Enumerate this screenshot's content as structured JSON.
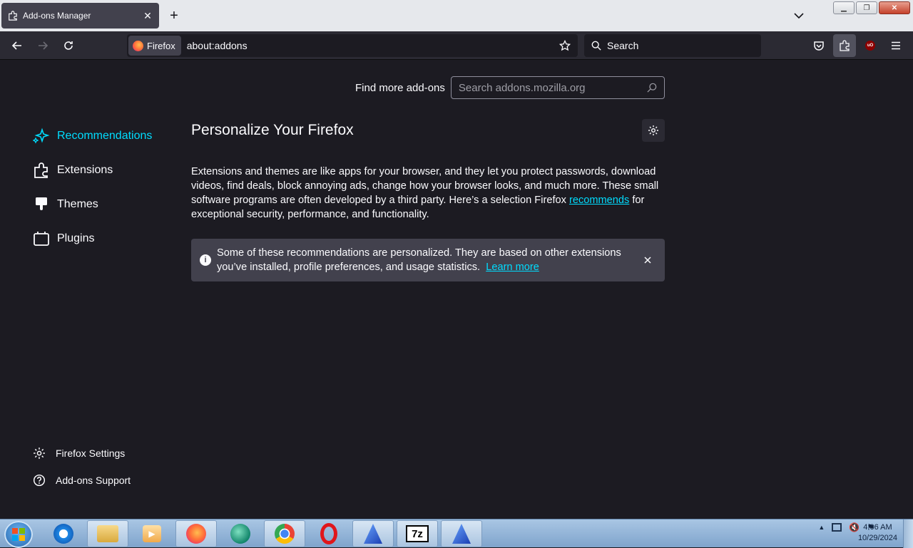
{
  "tab": {
    "title": "Add-ons Manager"
  },
  "navbar": {
    "identity_label": "Firefox",
    "url": "about:addons",
    "search_placeholder": "Search"
  },
  "find_more": {
    "label": "Find more add-ons",
    "search_placeholder": "Search addons.mozilla.org"
  },
  "sidebar": {
    "categories": [
      {
        "label": "Recommendations",
        "icon": "sparkle-icon",
        "selected": true
      },
      {
        "label": "Extensions",
        "icon": "puzzle-icon"
      },
      {
        "label": "Themes",
        "icon": "brush-icon"
      },
      {
        "label": "Plugins",
        "icon": "plugin-icon"
      }
    ],
    "footer": [
      {
        "label": "Firefox Settings",
        "icon": "gear-icon"
      },
      {
        "label": "Add-ons Support",
        "icon": "help-icon"
      }
    ]
  },
  "main": {
    "title": "Personalize Your Firefox",
    "intro_before_link": "Extensions and themes are like apps for your browser, and they let you protect passwords, download videos, find deals, block annoying ads, change how your browser looks, and much more. These small software programs are often developed by a third party. Here’s a selection Firefox ",
    "intro_link": "recommends",
    "intro_after_link": " for exceptional security, performance, and functionality.",
    "notice_text": "Some of these recommendations are personalized. They are based on other extensions you’ve installed, profile preferences, and usage statistics.",
    "notice_link": "Learn more"
  },
  "toolbar": {
    "ublock_badge": "uO"
  },
  "taskbar": {
    "time": "4:06 AM",
    "date": "10/29/2024",
    "archiver_label": "7z"
  },
  "colors": {
    "accent": "#00ddff",
    "page_bg": "#1c1b22",
    "toolbar_bg": "#2b2a33"
  }
}
